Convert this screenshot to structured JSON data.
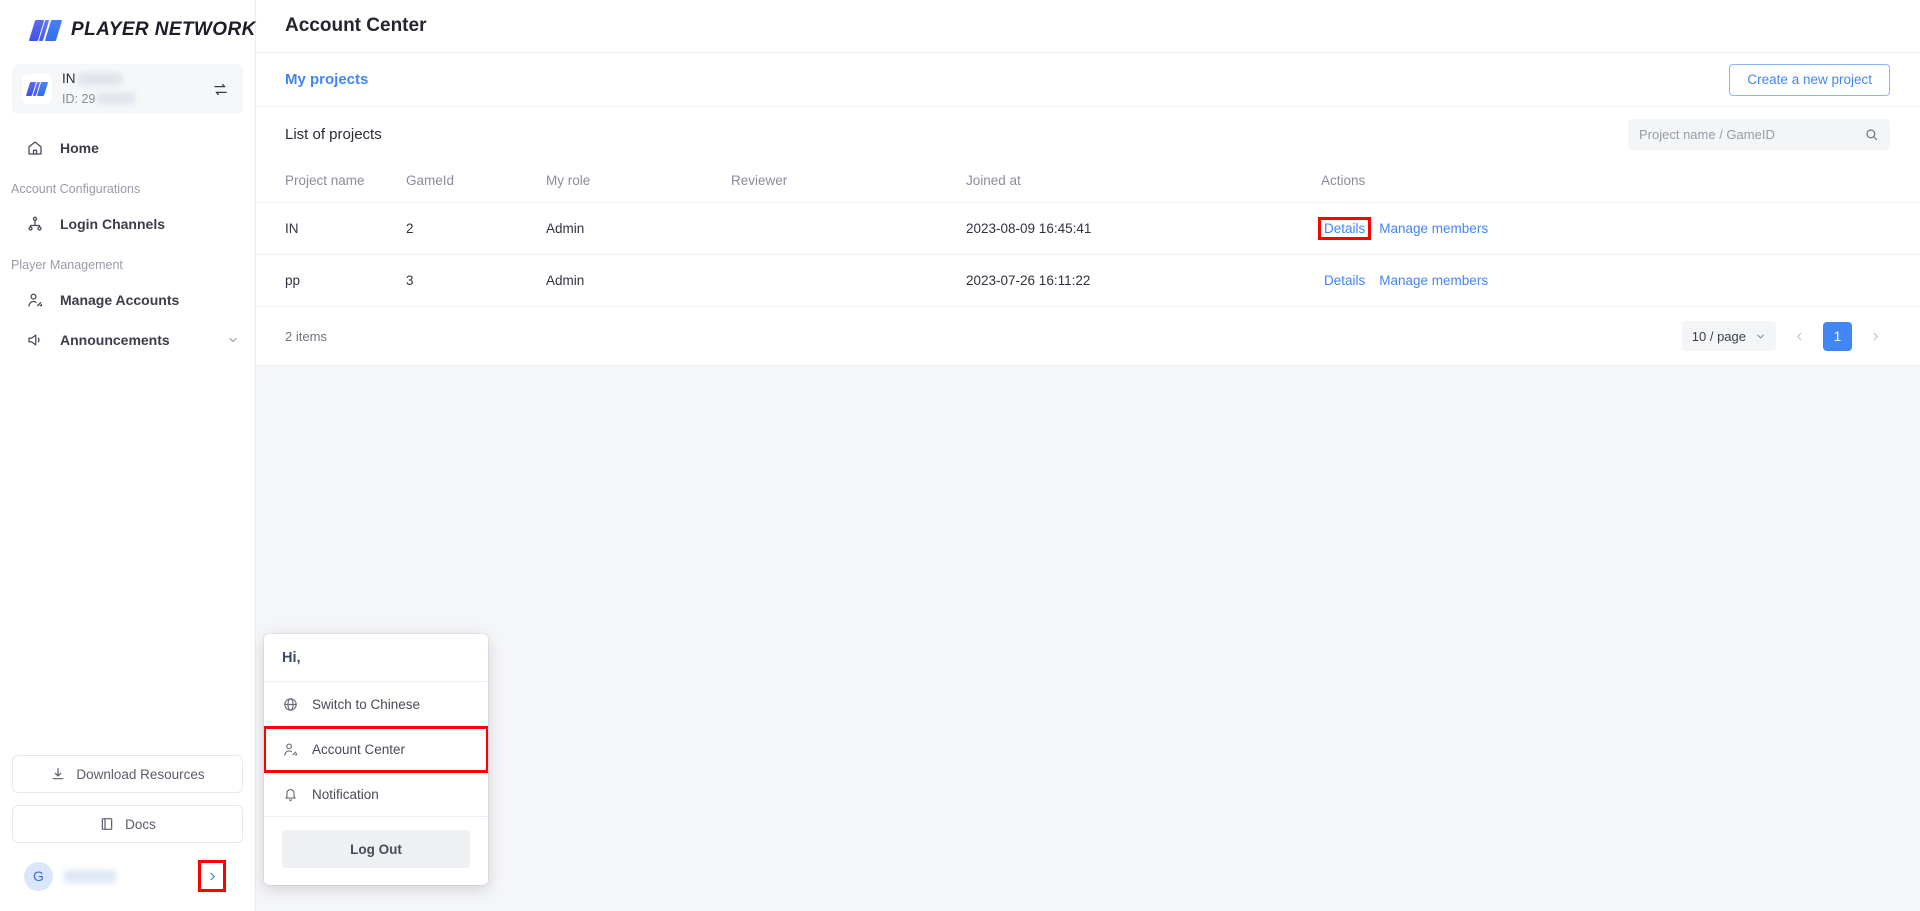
{
  "brand": {
    "name": "PLAYER NETWORK",
    "logo_icon": "player-network-logo-icon"
  },
  "project_switcher": {
    "name": "IN",
    "id_label": "ID: 29",
    "swap_icon": "swap-horizontal-icon"
  },
  "sidebar": {
    "items": [
      {
        "label": "Home",
        "icon": "home-icon",
        "type": "item"
      },
      {
        "label": "Account Configurations",
        "type": "group"
      },
      {
        "label": "Login Channels",
        "icon": "sitemap-icon",
        "type": "item"
      },
      {
        "label": "Player Management",
        "type": "group"
      },
      {
        "label": "Manage Accounts",
        "icon": "user-settings-icon",
        "type": "item"
      },
      {
        "label": "Announcements",
        "icon": "megaphone-icon",
        "type": "item",
        "expandable": true
      }
    ],
    "download_label": "Download Resources",
    "download_icon": "download-icon",
    "docs_label": "Docs",
    "docs_icon": "book-icon",
    "user_initial": "G",
    "expand_icon": "chevron-right-icon"
  },
  "header": {
    "title": "Account Center"
  },
  "subbar": {
    "tab_label": "My projects",
    "create_button": "Create a new project"
  },
  "panel": {
    "title": "List of projects",
    "search": {
      "placeholder": "Project name / GameID",
      "value": "",
      "icon": "search-icon"
    }
  },
  "table": {
    "columns": [
      "Project name",
      "GameId",
      "My role",
      "Reviewer",
      "Joined at",
      "Actions"
    ],
    "rows": [
      {
        "project_name": "IN",
        "game_id": "2",
        "my_role": "Admin",
        "reviewer": "",
        "joined_at": "2023-08-09 16:45:41",
        "actions": {
          "details": "Details",
          "manage": "Manage members"
        },
        "details_highlighted": true
      },
      {
        "project_name": "pp",
        "game_id": "3",
        "my_role": "Admin",
        "reviewer": "",
        "joined_at": "2023-07-26 16:11:22",
        "actions": {
          "details": "Details",
          "manage": "Manage members"
        },
        "details_highlighted": false
      }
    ]
  },
  "footer": {
    "items_count": "2 items",
    "page_size": "10 / page",
    "prev_icon": "chevron-left-icon",
    "next_icon": "chevron-right-icon",
    "current_page": "1"
  },
  "popup": {
    "greeting": "Hi,",
    "items": [
      {
        "label": "Switch to Chinese",
        "icon": "globe-icon",
        "highlighted": false
      },
      {
        "label": "Account Center",
        "icon": "user-account-icon",
        "highlighted": true
      },
      {
        "label": "Notification",
        "icon": "bell-icon",
        "highlighted": false
      }
    ],
    "logout": "Log Out"
  },
  "colors": {
    "accent_blue": "#4285f4",
    "highlight_red": "#fe0000",
    "sidebar_bg": "#ffffff",
    "page_bg": "#f5f6f8"
  }
}
